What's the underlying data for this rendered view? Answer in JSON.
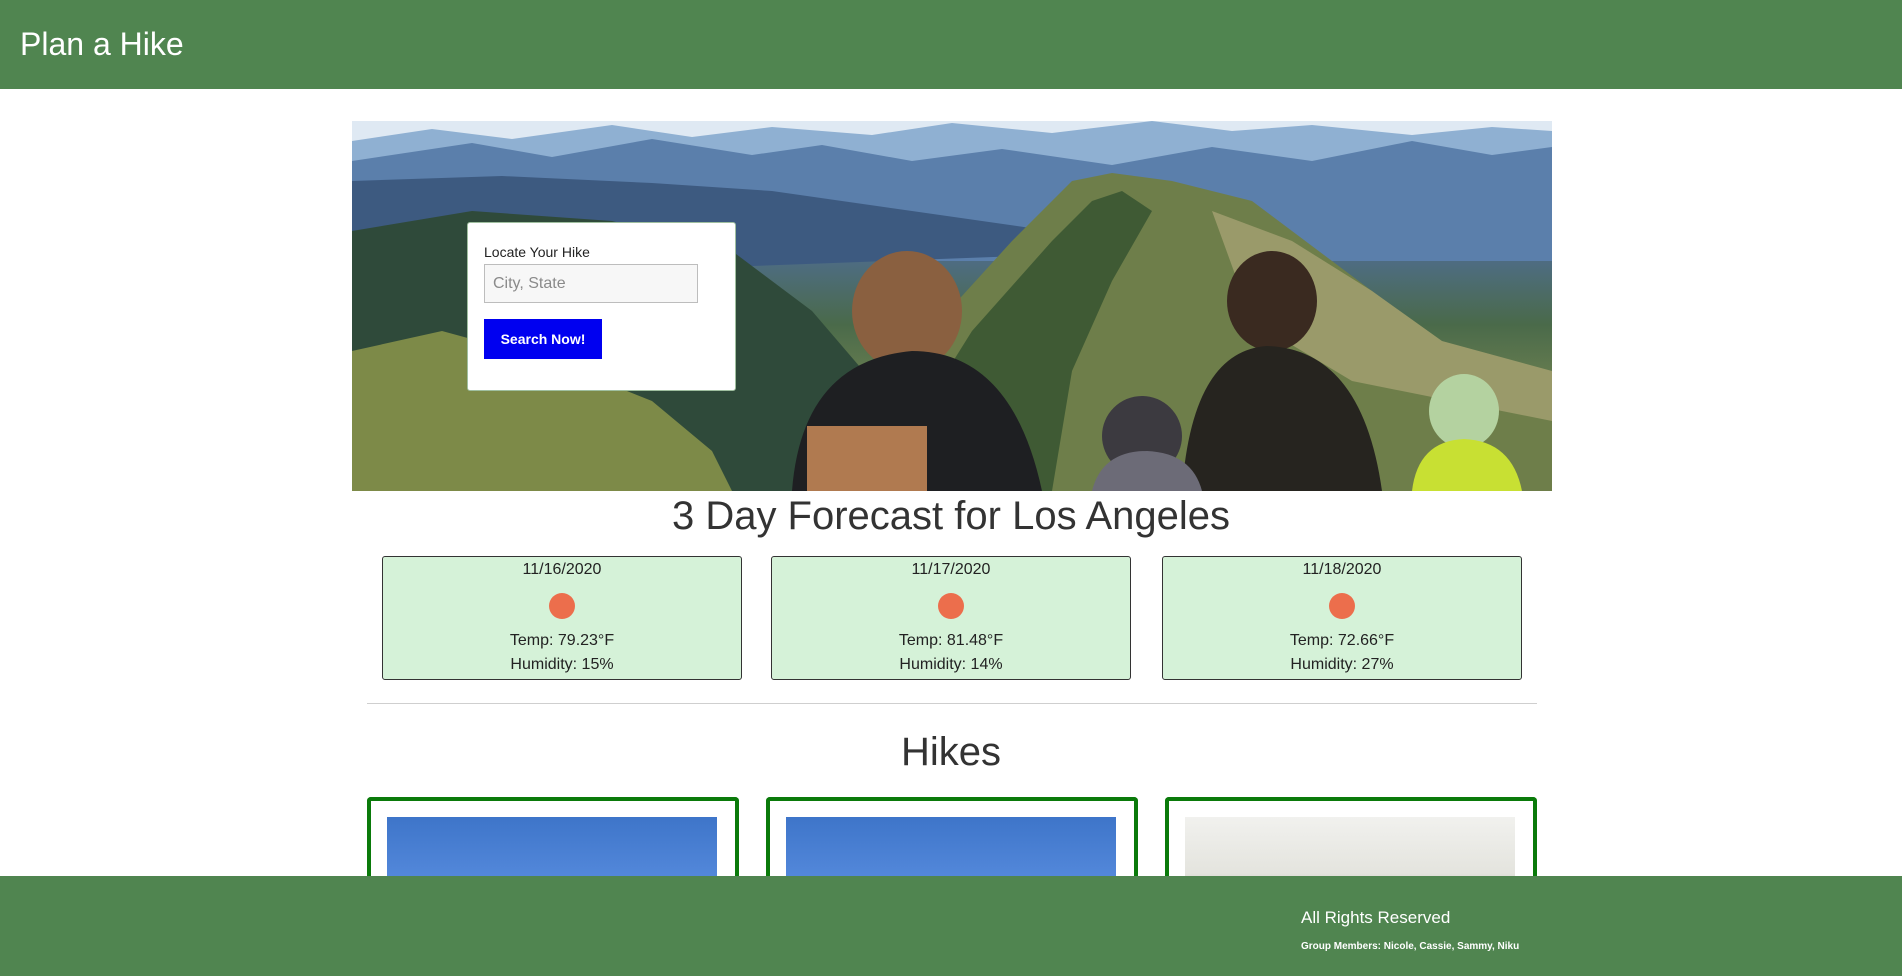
{
  "header": {
    "brand": "Plan a Hike"
  },
  "search": {
    "label": "Locate Your Hike",
    "placeholder": "City, State",
    "value": "",
    "button_label": "Search Now!"
  },
  "forecast": {
    "title": "3 Day Forecast for Los Angeles",
    "days": [
      {
        "date": "11/16/2020",
        "icon": "sun-icon",
        "temp": "Temp: 79.23°F",
        "humidity": "Humidity: 15%"
      },
      {
        "date": "11/17/2020",
        "icon": "sun-icon",
        "temp": "Temp: 81.48°F",
        "humidity": "Humidity: 14%"
      },
      {
        "date": "11/18/2020",
        "icon": "sun-icon",
        "temp": "Temp: 72.66°F",
        "humidity": "Humidity: 27%"
      }
    ]
  },
  "hikes": {
    "title": "Hikes"
  },
  "footer": {
    "rights": "All Rights Reserved",
    "members": "Group Members: Nicole, Cassie, Sammy, Niku"
  },
  "colors": {
    "header_bg": "#508550",
    "footer_bg": "#508550",
    "button_bg": "#0000f0",
    "forecast_card_bg": "#d5f2d8",
    "hike_card_border": "#0a7a0a",
    "sun": "#ec6e4c"
  }
}
